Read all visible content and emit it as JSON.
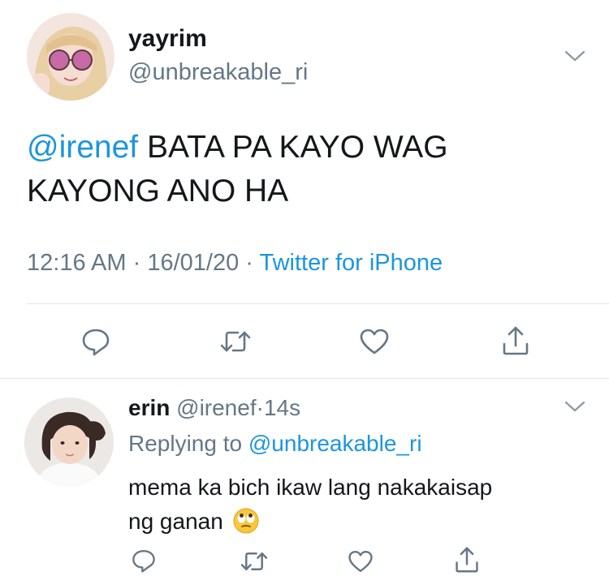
{
  "main_tweet": {
    "avatar": "avatar-yayrim",
    "display_name": "yayrim",
    "handle": "@unbreakable_ri",
    "mention": "@irenef",
    "text_line1": " BATA PA KAYO WAG",
    "text_line2": "KAYONG ANO HA",
    "time": "12:16 AM",
    "sep1": "·",
    "date": "16/01/20",
    "sep2": "·",
    "source": "Twitter for iPhone"
  },
  "reply_tweet": {
    "avatar": "avatar-erin",
    "display_name": "erin",
    "handle": "@irenef",
    "sep": "·",
    "age": "14s",
    "replying_prefix": "Replying to ",
    "replying_to": "@unbreakable_ri",
    "text_line1": "mema ka bich ikaw lang nakakaisap",
    "text_line2": "ng ganan",
    "emoji": "🙄"
  },
  "actions": [
    "reply-icon",
    "retweet-icon",
    "like-icon",
    "share-icon"
  ],
  "colors": {
    "link": "#1b95e0",
    "secondary_text": "#657786",
    "icon": "#657786",
    "divider": "#e1e8ed"
  }
}
